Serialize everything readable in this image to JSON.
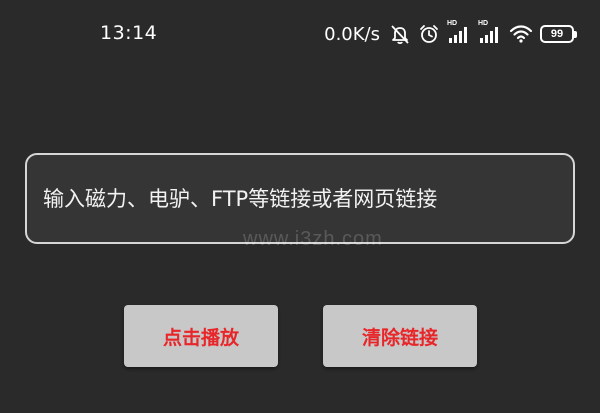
{
  "status_bar": {
    "time": "13:14",
    "net_speed": "0.0K/s",
    "icons": [
      "mute-icon",
      "alarm-icon",
      "signal-hd-icon",
      "signal-hd-icon",
      "wifi-icon",
      "battery-icon"
    ],
    "hd_label": "HD",
    "battery_level": "99"
  },
  "link_input": {
    "placeholder": "输入磁力、电驴、FTP等链接或者网页链接",
    "value": ""
  },
  "watermark": {
    "text": "www.i3zh.com"
  },
  "buttons": {
    "play_label": "点击播放",
    "clear_label": "清除链接"
  },
  "colors": {
    "background": "#2a2a2a",
    "input_border": "#d6d6d6",
    "button_bg": "#c8c8c8",
    "button_text": "#e8262a"
  }
}
